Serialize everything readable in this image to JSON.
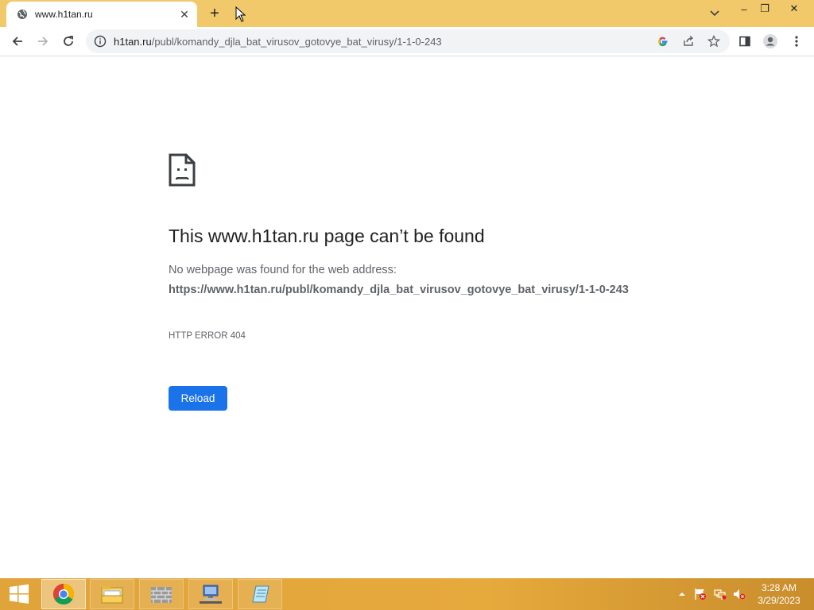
{
  "browser": {
    "tab": {
      "title": "www.h1tan.ru",
      "close_glyph": "✕"
    },
    "new_tab_glyph": "+",
    "window_controls": {
      "minimize": "–",
      "restore": "❐",
      "close": "✕"
    }
  },
  "toolbar": {
    "url_host": "h1tan.ru",
    "url_path": "/publ/komandy_djla_bat_virusov_gotovye_bat_virusy/1-1-0-243"
  },
  "error_page": {
    "title": "This www.h1tan.ru page can’t be found",
    "description": "No webpage was found for the web address:",
    "url": "https://www.h1tan.ru/publ/komandy_djla_bat_virusov_gotovye_bat_virusy/1-1-0-243",
    "code": "HTTP ERROR 404",
    "reload_label": "Reload"
  },
  "taskbar": {
    "time": "3:28 AM",
    "date": "3/29/2023",
    "apps": [
      "chrome-icon",
      "file-explorer-icon",
      "firewall-icon",
      "network-computer-icon",
      "notepad-icon"
    ]
  },
  "colors": {
    "titlebar": "#f1c96a",
    "accent": "#1a73e8",
    "taskbar": "#e0a43a"
  }
}
